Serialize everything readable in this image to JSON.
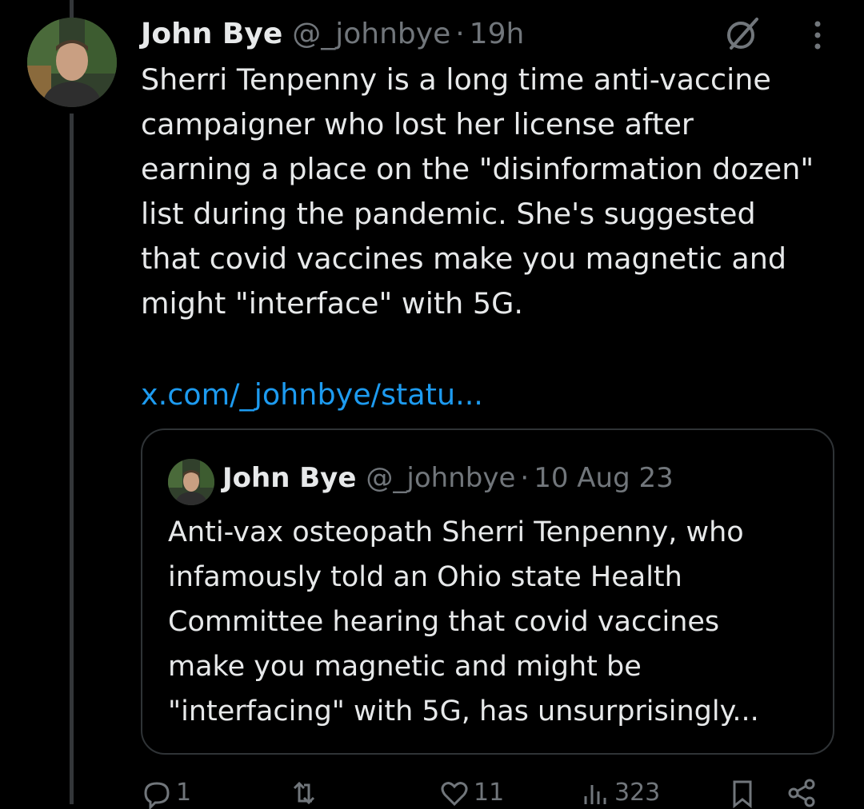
{
  "tweet": {
    "author_name": "John Bye",
    "author_handle": "@_johnbye",
    "separator": "·",
    "time": "19h",
    "text": "Sherri Tenpenny is a long time anti-vaccine\ncampaigner who lost her license after\nearning a place on the \"disinformation dozen\"\nlist during the pandemic. She's suggested\nthat covid vaccines make you magnetic and\nmight \"interface\" with 5G.",
    "link": "x.com/_johnbye/statu..."
  },
  "quoted_tweet": {
    "author_name": "John Bye",
    "author_handle": "@_johnbye",
    "separator": "·",
    "time": "10 Aug 23",
    "text": "Anti-vax osteopath Sherri Tenpenny, who\ninfamously told an Ohio state Health\nCommittee hearing that covid vaccines\nmake you magnetic and might be\n\"interfacing\" with 5G, has unsurprisingly..."
  },
  "actions": {
    "reply_count": "1",
    "like_count": "11",
    "views_count": "323"
  },
  "colors": {
    "background": "#000000",
    "text": "#e7e9ea",
    "secondary": "#71767b",
    "link": "#1d9bf0",
    "border": "#2f3336"
  },
  "icons": {
    "grok": "grok-icon",
    "more": "more-icon",
    "reply": "reply-icon",
    "retweet": "retweet-icon",
    "like": "heart-icon",
    "views": "views-icon",
    "bookmark": "bookmark-icon",
    "share": "share-icon"
  }
}
